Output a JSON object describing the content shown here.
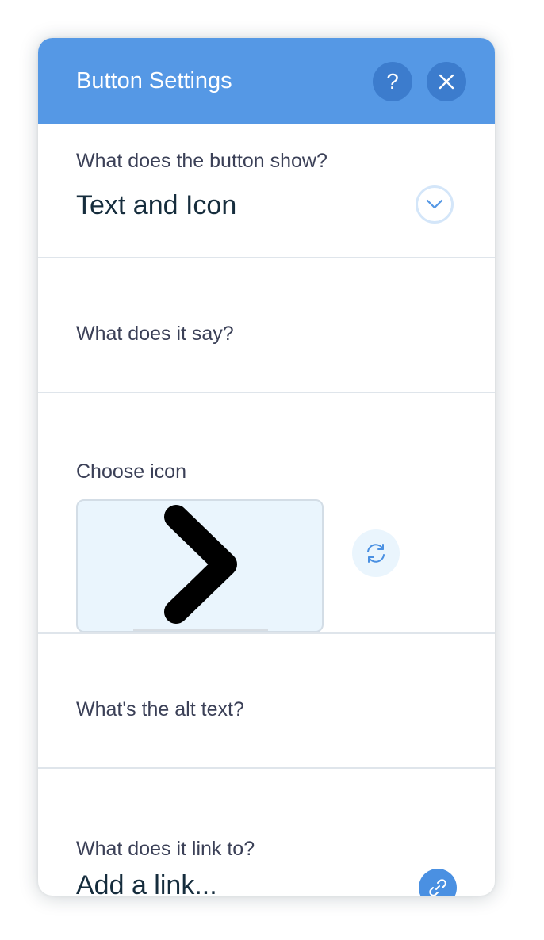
{
  "header": {
    "title": "Button Settings",
    "help_label": "?",
    "accent_color": "#5598e5",
    "icons": [
      "help-icon",
      "close-icon"
    ]
  },
  "sections": {
    "display": {
      "label": "What does the button show?",
      "value": "Text and Icon",
      "icon": "chevron-down-icon"
    },
    "text": {
      "label": "What does it say?"
    },
    "icon": {
      "label": "Choose icon",
      "selected_icon": "chevron-right-icon",
      "change_icon": "refresh-icon"
    },
    "alt_text": {
      "label": "What's the alt text?"
    },
    "link": {
      "label": "What does it link to?",
      "value": "Add a link...",
      "icon": "link-icon"
    }
  }
}
